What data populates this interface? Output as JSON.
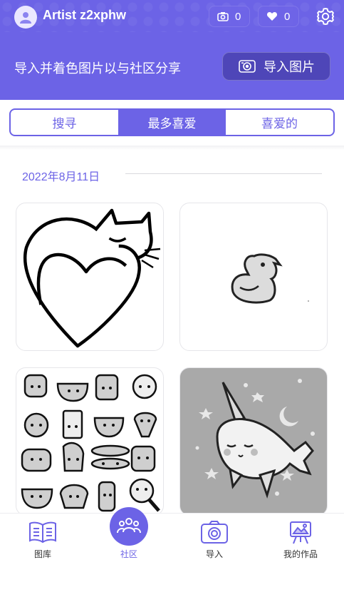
{
  "user": {
    "name": "Artist z2xphw"
  },
  "stats": {
    "photos": "0",
    "likes": "0"
  },
  "banner": {
    "text": "导入并着色图片以与社区分享",
    "import_label": "导入图片"
  },
  "tabs": [
    {
      "label": "搜寻",
      "active": false
    },
    {
      "label": "最多喜爱",
      "active": true
    },
    {
      "label": "喜爱的",
      "active": false
    }
  ],
  "feed": {
    "date": "2022年8月11日",
    "items": [
      {
        "name": "cat-heart-artwork"
      },
      {
        "name": "duck-artwork"
      },
      {
        "name": "kawaii-food-artwork"
      },
      {
        "name": "narwhal-artwork"
      }
    ]
  },
  "nav": {
    "gallery": "图库",
    "community": "社区",
    "import": "导入",
    "works": "我的作品"
  },
  "colors": {
    "accent": "#6c63e6",
    "dark_accent": "#4e46b8"
  },
  "icons": [
    "user-icon",
    "camera-icon",
    "heart-icon",
    "gear-icon",
    "book-icon",
    "people-icon",
    "easel-icon"
  ]
}
